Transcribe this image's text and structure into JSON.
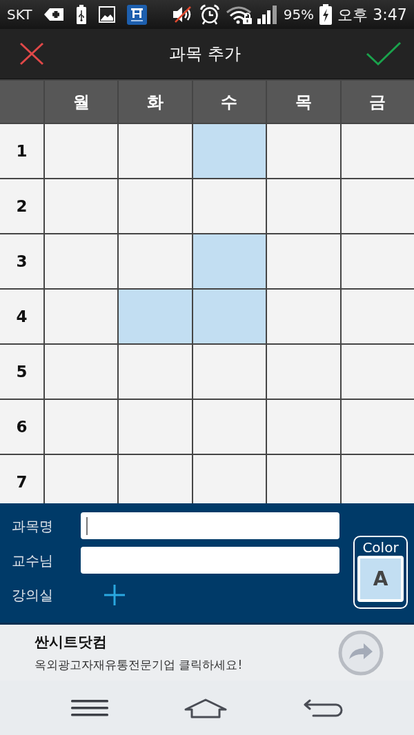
{
  "status_bar": {
    "carrier": "SKT",
    "battery": "95%",
    "time": "오후 3:47"
  },
  "app_bar": {
    "title": "과목 추가"
  },
  "timetable": {
    "days": [
      "월",
      "화",
      "수",
      "목",
      "금"
    ],
    "periods": [
      {
        "label": "1",
        "cells": [
          {
            "selected": false
          },
          {
            "selected": false
          },
          {
            "selected": true
          },
          {
            "selected": false
          },
          {
            "selected": false
          }
        ]
      },
      {
        "label": "2",
        "cells": [
          {
            "selected": false
          },
          {
            "selected": false
          },
          {
            "selected": false
          },
          {
            "selected": false
          },
          {
            "selected": false
          }
        ]
      },
      {
        "label": "3",
        "cells": [
          {
            "selected": false
          },
          {
            "selected": false
          },
          {
            "selected": true
          },
          {
            "selected": false
          },
          {
            "selected": false
          }
        ]
      },
      {
        "label": "4",
        "cells": [
          {
            "selected": false
          },
          {
            "selected": true
          },
          {
            "selected": true
          },
          {
            "selected": false
          },
          {
            "selected": false
          }
        ]
      },
      {
        "label": "5",
        "cells": [
          {
            "selected": false
          },
          {
            "selected": false
          },
          {
            "selected": false
          },
          {
            "selected": false
          },
          {
            "selected": false
          }
        ]
      },
      {
        "label": "6",
        "cells": [
          {
            "selected": false
          },
          {
            "selected": false
          },
          {
            "selected": false
          },
          {
            "selected": false
          },
          {
            "selected": false
          }
        ]
      },
      {
        "label": "7",
        "cells": [
          {
            "selected": false
          },
          {
            "selected": false
          },
          {
            "selected": false
          },
          {
            "selected": false
          },
          {
            "selected": false
          }
        ]
      }
    ]
  },
  "form": {
    "fields": [
      {
        "label": "과목명",
        "kind": "text",
        "focused": true
      },
      {
        "label": "교수님",
        "kind": "text",
        "focused": false
      },
      {
        "label": "강의실",
        "kind": "add"
      }
    ],
    "color_picker": {
      "label": "Color",
      "sample": "A",
      "color": "#c2def2"
    }
  },
  "ad": {
    "title": "싼시트닷컴",
    "text": "옥외광고자재유통전문기업 클릭하세요!"
  }
}
